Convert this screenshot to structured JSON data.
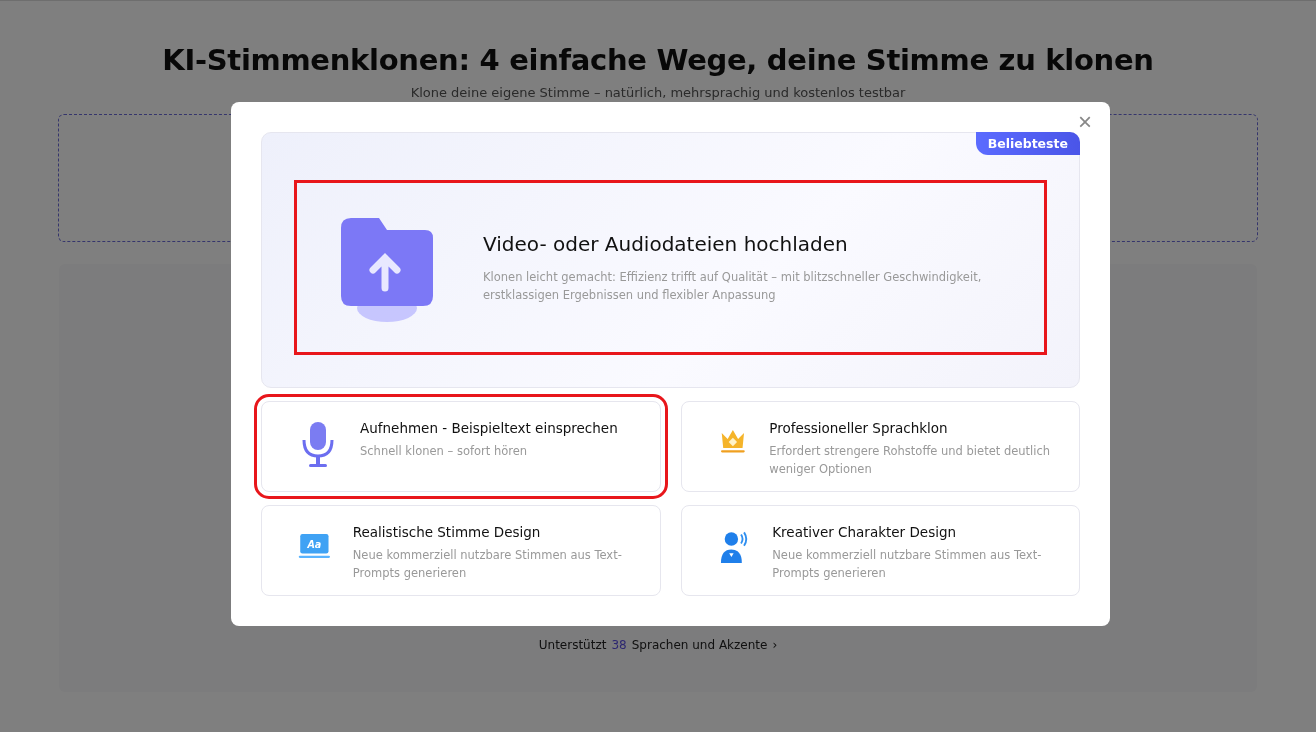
{
  "page": {
    "title": "KI-Stimmenklonen: 4 einfache Wege, deine Stimme zu klonen",
    "subtitle": "Klone deine eigene Stimme – natürlich, mehrsprachig und kostenlos testbar",
    "footer_link": {
      "prefix": "Unterstützt",
      "count": "38",
      "suffix": "Sprachen und Akzente",
      "chevron": "›"
    }
  },
  "modal": {
    "close": "×",
    "featured": {
      "badge": "Beliebteste",
      "title": "Video- oder Audiodateien hochladen",
      "description": "Klonen leicht gemacht: Effizienz trifft auf Qualität – mit blitzschneller Geschwindigkeit, erstklassigen Ergebnissen und flexibler Anpassung",
      "highlighted": true
    },
    "options": [
      {
        "kind": "microphone",
        "title": "Aufnehmen - Beispieltext einsprechen",
        "description": "Schnell klonen – sofort hören",
        "highlighted": true
      },
      {
        "kind": "crown",
        "title": "Professioneller Sprachklon",
        "description": "Erfordert strengere Rohstoffe und bietet deutlich weniger Optionen",
        "highlighted": false
      },
      {
        "kind": "text-screen",
        "icon_label": "Aa",
        "title": "Realistische Stimme Design",
        "description": "Neue kommerziell nutzbare Stimmen aus Text-Prompts generieren",
        "highlighted": false
      },
      {
        "kind": "speaker-person",
        "title": "Kreativer Charakter Design",
        "description": "Neue kommerziell nutzbare Stimmen aus Text-Prompts generieren",
        "highlighted": false
      }
    ]
  }
}
